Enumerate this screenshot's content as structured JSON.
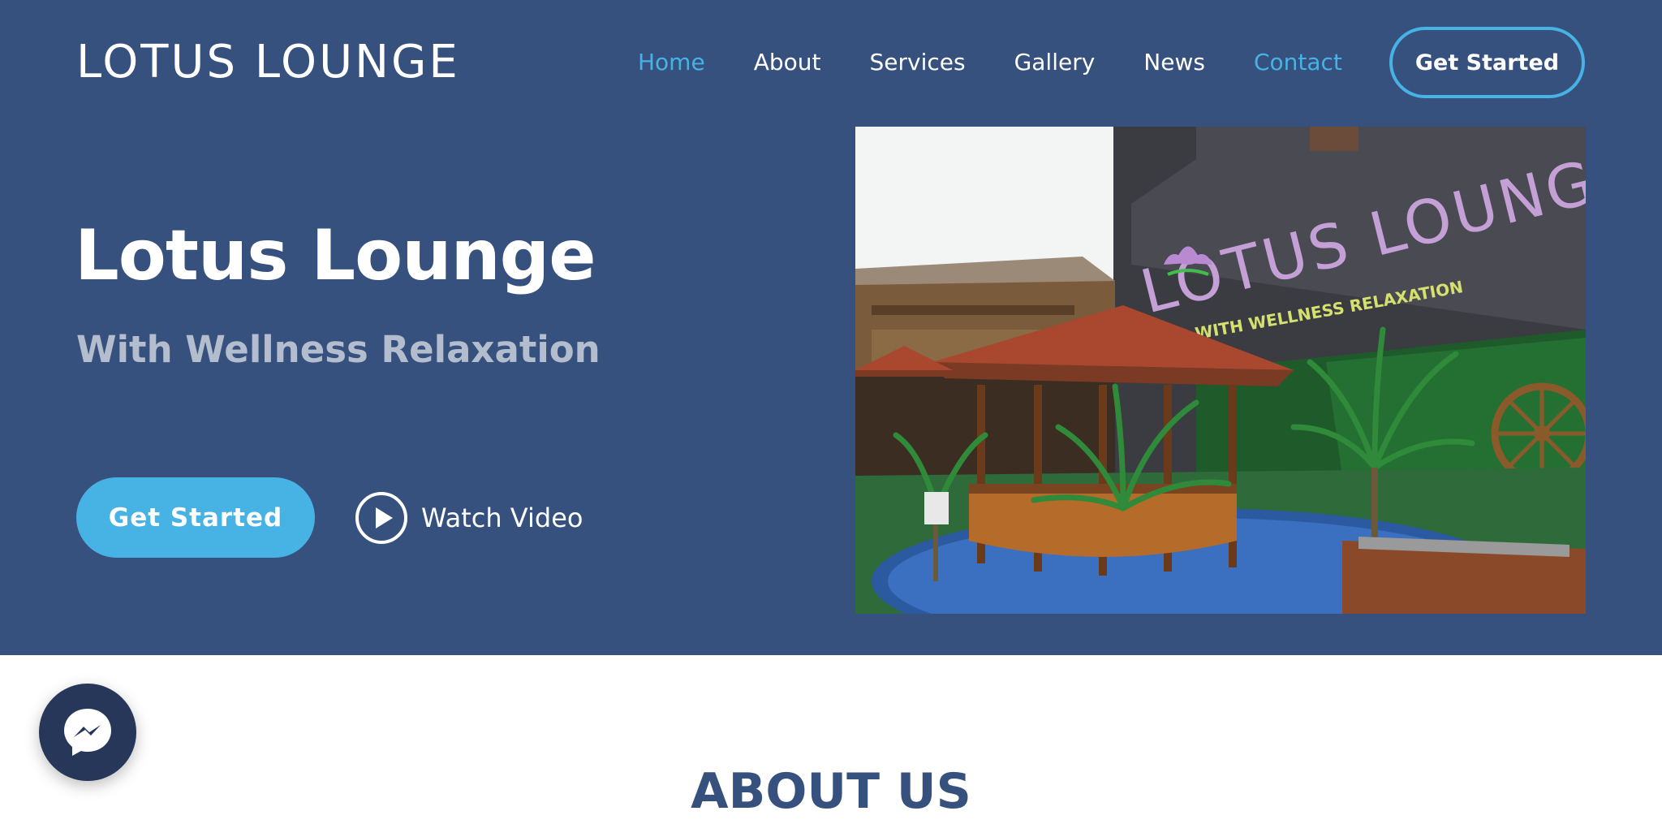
{
  "header": {
    "logo": "LOTUS LOUNGE",
    "nav": [
      {
        "label": "Home",
        "active": true
      },
      {
        "label": "About",
        "active": false
      },
      {
        "label": "Services",
        "active": false
      },
      {
        "label": "Gallery",
        "active": false
      },
      {
        "label": "News",
        "active": false
      },
      {
        "label": "Contact",
        "active": true
      }
    ],
    "cta_label": "Get Started"
  },
  "hero": {
    "title": "Lotus Lounge",
    "subtitle": "With Wellness Relaxation",
    "cta_label": "Get Started",
    "watch_video_label": "Watch Video",
    "image": {
      "sign_text": "LOTUS LOUNGE",
      "sign_subtext": "WITH WELLNESS RELAXATION"
    }
  },
  "about": {
    "title": "ABOUT US"
  },
  "icons": {
    "play": "play-circle-icon",
    "messenger": "messenger-icon"
  },
  "colors": {
    "hero_bg": "#37517e",
    "accent": "#47b2e4",
    "white": "#ffffff"
  }
}
